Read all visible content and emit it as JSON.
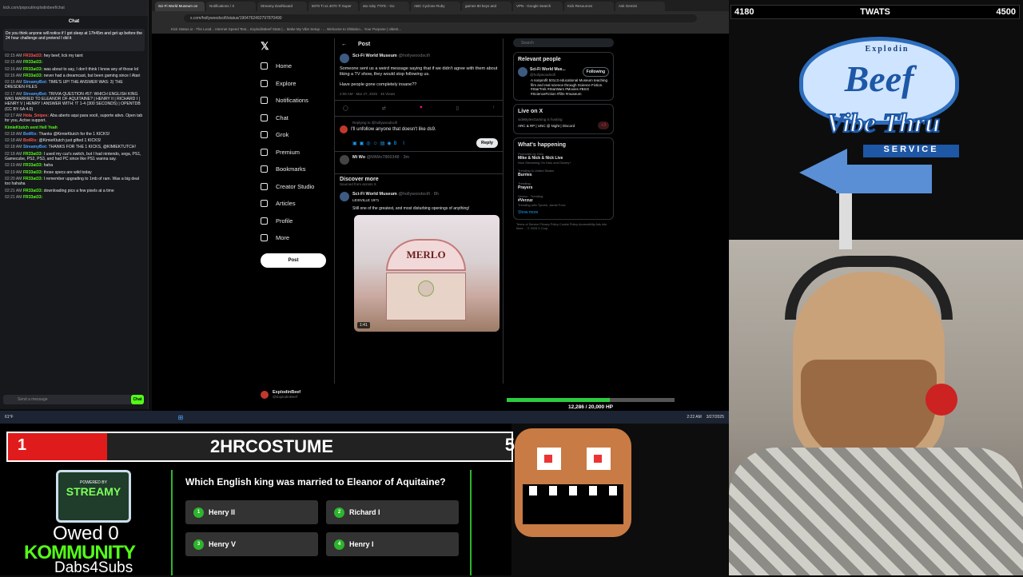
{
  "chat": {
    "url": "kick.com/popout/explodinbeef/chat",
    "title": "Chat",
    "pinned": "Do you think anyone will notice if I got sleep at 17h45m and get up before the 24 hour challenge and pretend I did it",
    "messages": [
      {
        "ts": "02:15 AM",
        "user": "FR33at33:",
        "text": "hey beef, lick my taint",
        "color": "r"
      },
      {
        "ts": "02:15 AM",
        "user": "FR33at33:",
        "text": "",
        "color": "g"
      },
      {
        "ts": "02:16 AM",
        "user": "FR33at33:",
        "text": "was about to say, I don't think I know any of those lol",
        "color": "g"
      },
      {
        "ts": "02:16 AM",
        "user": "FR33at33:",
        "text": "never had a dreamcast, but been gaming since I Atari",
        "color": "g"
      },
      {
        "ts": "02:16 AM",
        "user": "StreamyBot:",
        "text": "TIME'S UP! THE ANSWER WAS: 3) THE DRESDEN FILES",
        "color": "b"
      },
      {
        "ts": "02:17 AM",
        "user": "StreamyBot:",
        "text": "TRIVIA QUESTION #57: WHICH ENGLISH KING WAS MARRIED TO ELEANOR OF AQUITAINE? | HENRY II | RICHARD I | HENRY V | HENRY I ANSWER WITH: !T 1-4 (300 SECONDS) | OPENTDB (CC BY-SA 4.0)",
        "color": "b"
      },
      {
        "ts": "02:17 AM",
        "user": "Hola_Snipes:",
        "text": "Aba aberto aqui para você, suporte ativo. Open tab for you, Active support.",
        "color": "r"
      },
      {
        "ts": "",
        "user": "KimieKtutch sent Hell Yeah",
        "text": "",
        "color": "g"
      },
      {
        "ts": "02:18 AM",
        "user": "BotRix:",
        "text": "Thanks @KimieKtutch for the 1 KICKS!",
        "color": "b"
      },
      {
        "ts": "02:18 AM",
        "user": "BotRix:",
        "text": "@KimieKtutch just gifted 1 KICKS!",
        "color": "r"
      },
      {
        "ts": "02:18 AM",
        "user": "StreamyBot:",
        "text": "THANKS FOR THE 1 KICKS, @KIMIEKTUTCH!",
        "color": "b"
      },
      {
        "ts": "02:18 AM",
        "user": "FR33at33:",
        "text": "I used my cuz's switch, but I had nintendo, sega, PS1, Gamecube, PS2, PS3, and had PC since like PS1 wanna say.",
        "color": "g"
      },
      {
        "ts": "02:19 AM",
        "user": "FR33at33:",
        "text": "haha",
        "color": "g"
      },
      {
        "ts": "02:19 AM",
        "user": "FR33at33:",
        "text": "those specs are wild today",
        "color": "g"
      },
      {
        "ts": "02:20 AM",
        "user": "FR33at33:",
        "text": "I remember upgrading to 1mb of ram. Was a big deal too hahaha",
        "color": "g"
      },
      {
        "ts": "02:21 AM",
        "user": "FR33at33:",
        "text": "downloading pics a few pixels at a time",
        "color": "g"
      },
      {
        "ts": "02:21 AM",
        "user": "FR33at33:",
        "text": "",
        "color": "g"
      }
    ],
    "send_placeholder": "Send a message",
    "chat_button": "Chat"
  },
  "browser": {
    "tabs": [
      "Sci-Fi World Museum on",
      "Notifications / X",
      "Streamy Dashboard",
      "5070 Ti vs 4070 Ti Super",
      "ato ruby 770Tc - Go",
      "ABC Cyclone Ruby",
      "games 80 keys and",
      "VPN - Google Search",
      "Kick Resources",
      "Ask Gemini"
    ],
    "url": "x.com/hollywoodscifi/status/1904762492797870490",
    "bookmarks": "Kick  Status.io - The Lead...  Internet Speed Test...  ExplodinBeef Stats |...  Make My Vibe Setup - ...  Welcome to Oblatino...  Your Purpose | oldest..."
  },
  "x": {
    "nav": [
      "Home",
      "Explore",
      "Notifications",
      "Chat",
      "Grok",
      "Premium",
      "Bookmarks",
      "Creator Studio",
      "Articles",
      "Profile",
      "More"
    ],
    "post_button": "Post",
    "header": "Post",
    "account_name": "ExplodinBeef",
    "account_handle": "@ExplodinBeef",
    "tweet": {
      "name": "Sci-Fi World Museum",
      "handle": "@hollywoodscifi",
      "text1": "Someone sent us a weird message saying that if we didn't agree with them about liking a TV show, they would stop following us.",
      "text2": "Have people gone completely insane??",
      "meta": "2:06 AM · Mar 27, 2025 · 45 Views"
    },
    "reply": {
      "replying": "Replying to @hollywoodscifi",
      "text": "I'll unfollow anyone that doesn't like ds9.",
      "button": "Reply"
    },
    "reply2": {
      "name": "Mi Wo",
      "handle": "@MiWo7866348 · 3m"
    },
    "discover_title": "Discover more",
    "discover_sub": "Sourced from across X",
    "tweet2": {
      "name": "Sci-Fi World Museum",
      "handle": "@hollywoodscifi · 8h",
      "location": "LEISVILLE 1971",
      "text": "Still one of the greatest, and most disturbing openings of anything!",
      "video_sign": "MERLO",
      "duration": "1:41"
    },
    "search_placeholder": "Search",
    "relevant_title": "Relevant people",
    "relevant_name": "Sci-Fi World Mus...",
    "relevant_handle": "@hollywoodscifi",
    "relevant_bio": "A nonprofit 501c3 educational Museum teaching film and real science through Science Fiction. #StarTrek #StarWars #Movies #BSG #ScienceFiction #film #museum",
    "following": "Following",
    "live_title": "Live on X",
    "live_host": "sideBytesGaming is hosting",
    "live_text": "ARC & RP | UNC @ Night | Discord",
    "live_count": "+3",
    "happening_title": "What's happening",
    "happening": [
      {
        "t": "Mike & Nick & Nick Live",
        "s": "Now Streaming On Hulu and Disney+",
        "m": "Promoted by Hulu"
      },
      {
        "t": "Burries",
        "s": "",
        "m": "Trending in United States"
      },
      {
        "t": "Prayers",
        "s": "",
        "m": "Trending"
      },
      {
        "t": "#Verzuz",
        "s": "Trending with Tyreek, Jamie Foxx",
        "m": "Verzuz · Trending"
      }
    ],
    "show_more": "Show more",
    "footer": "Terms of Service  Privacy Policy  Cookie Policy  Accessibility  Ads info  More ... © 2025 X Corp."
  },
  "hp": {
    "label": "12,286 / 20,000 HP",
    "fill": 0.614
  },
  "overlay": {
    "top_left": "4180",
    "top_center": "TWATS",
    "top_right": "4500",
    "logo_line1": "Explodin",
    "logo_line2": "Beef",
    "logo_line3": "Vibe Thru",
    "logo_line4": "SERVICE"
  },
  "trivia": {
    "count": "1",
    "code": "2HRCOSTUME",
    "right_digit": "5",
    "question": "Which English king was married to Eleanor of Aquitaine?",
    "answers": [
      {
        "n": "1",
        "label": "Henry II"
      },
      {
        "n": "2",
        "label": "Richard I"
      },
      {
        "n": "3",
        "label": "Henry V"
      },
      {
        "n": "4",
        "label": "Henry I"
      }
    ],
    "badge_top": "POWERED BY",
    "badge_main": "STREAMY",
    "owed": "Owed 0",
    "community": "KOMMUNITY",
    "dabs": "Dabs4Subs"
  },
  "taskbar": {
    "time": "2:22 AM",
    "date": "3/27/2025",
    "temp": "61°F"
  }
}
